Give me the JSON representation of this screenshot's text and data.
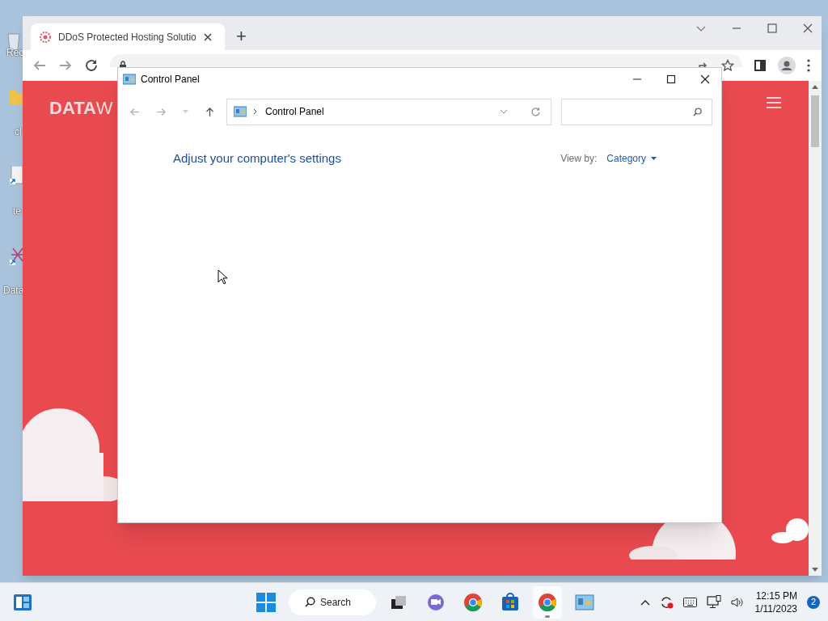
{
  "desktop": {
    "icons": [
      {
        "label": "Rec",
        "kind": "bin"
      },
      {
        "label": "cl",
        "kind": "folder"
      },
      {
        "label": "te",
        "kind": "file"
      },
      {
        "label": "Data",
        "kind": "app"
      }
    ]
  },
  "browser": {
    "tab": {
      "title": "DDoS Protected Hosting Solutio",
      "selected": true
    },
    "new_tab": "+",
    "logo": "**DATA**W"
  },
  "control_panel": {
    "title": "Control Panel",
    "breadcrumb": "Control Panel",
    "heading": "Adjust your computer's settings",
    "view_by_label": "View by:",
    "view_by_value": "Category"
  },
  "taskbar": {
    "search": "Search",
    "apps": [
      {
        "kind": "taskview",
        "active": false
      },
      {
        "kind": "chat",
        "active": false
      },
      {
        "kind": "chrome",
        "active": false
      },
      {
        "kind": "store",
        "active": false
      },
      {
        "kind": "chrome",
        "active": true
      },
      {
        "kind": "control",
        "active": false
      }
    ],
    "time": "12:15 PM",
    "date": "1/11/2023",
    "notifications": "2"
  }
}
